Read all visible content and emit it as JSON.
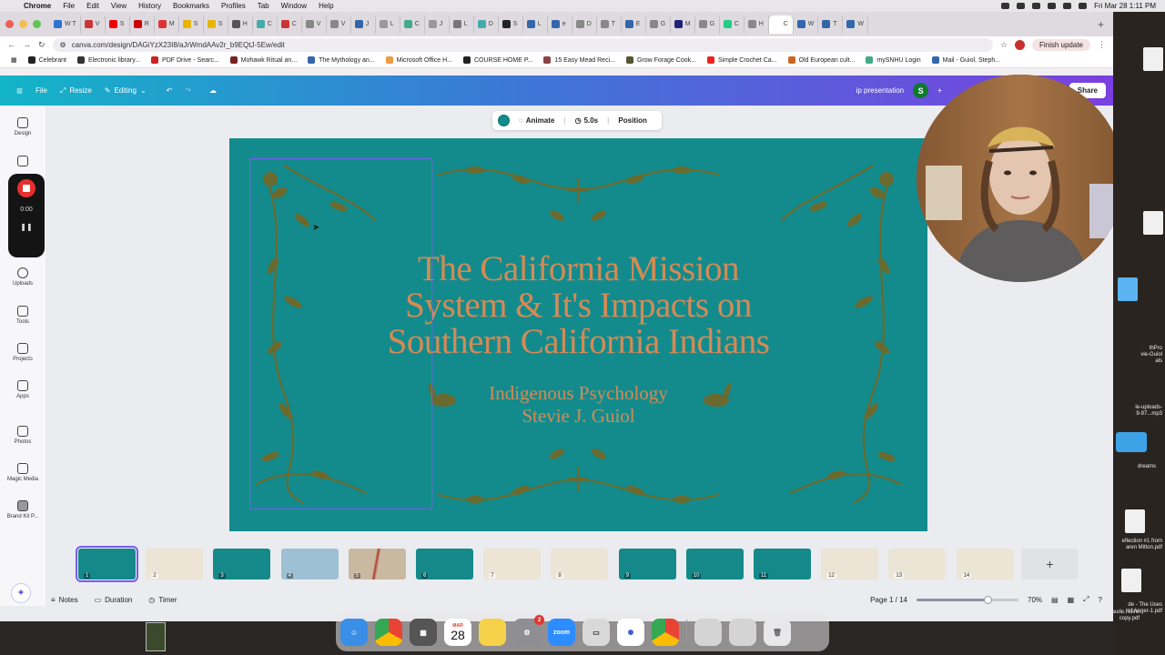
{
  "menubar": {
    "app": "Chrome",
    "items": [
      "File",
      "Edit",
      "View",
      "History",
      "Bookmarks",
      "Profiles",
      "Tab",
      "Window",
      "Help"
    ],
    "datetime": "Fri Mar 28  1:11 PM"
  },
  "browser": {
    "url": "canva.com/design/DAGiYzX23I8/aJrWmdAAv2r_b9EQtJ-5Ew/edit",
    "finish_update": "Finish update",
    "tabs": [
      "W T",
      "V",
      "S",
      "R",
      "M",
      "S",
      "S",
      "H",
      "C",
      "C",
      "V",
      "V",
      "J",
      "L",
      "C",
      "J",
      "L",
      "D",
      "S",
      "L",
      "e",
      "D",
      "T",
      "E",
      "G",
      "M",
      "G",
      "C",
      "H",
      "C",
      "W",
      "T",
      "W"
    ],
    "bookmarks": [
      "Celebrant",
      "Electronic library...",
      "PDF Drive - Searc...",
      "Mohawk Ritual an...",
      "The Mythology an...",
      "Microsoft Office H...",
      "COURSE HOME P...",
      "15 Easy Mead Reci...",
      "Grow Forage Cook...",
      "Simple Crochet Ca...",
      "Old European cult...",
      "mySNHU Login",
      "Mail - Guiol, Steph..."
    ]
  },
  "canva": {
    "header": {
      "file": "File",
      "resize": "Resize",
      "editing": "Editing",
      "design_name": "ip presentation",
      "avatar_letter": "S",
      "share": "Share"
    },
    "sidebar": [
      "Design",
      "Elements",
      "Uploads",
      "Tools",
      "Projects",
      "Apps",
      "Photos",
      "Magic Media",
      "Brand Kit P..."
    ],
    "recorder": {
      "time": "0:00"
    },
    "toolbar": {
      "animate": "Animate",
      "duration": "5.0s",
      "position": "Position"
    },
    "slide": {
      "title_lines": [
        "The California Mission",
        "System & It's Impacts on",
        "Southern California Indians"
      ],
      "subtitle_lines": [
        "Indigenous Psychology",
        "Stevie J. Guiol"
      ]
    },
    "pages": [
      "1",
      "2",
      "3",
      "4",
      "5",
      "6",
      "7",
      "8",
      "9",
      "10",
      "11",
      "12",
      "13",
      "14"
    ],
    "footer": {
      "notes": "Notes",
      "duration": "Duration",
      "timer": "Timer",
      "page_indicator": "Page 1 / 14",
      "zoom": "70%",
      "zoom_fraction": 0.7
    }
  },
  "colors": {
    "slide_bg": "#138b8c",
    "title": "#d68a55",
    "foliage": "#6b6a2e",
    "selection": "#7a5cf0"
  },
  "dock": {
    "calendar_month": "MAR",
    "calendar_day": "28",
    "settings_badge": "2",
    "zoom_label": "zoom"
  },
  "desktop_labels": [
    "thPro\nvie-Guiol\nals",
    "le-uploads-\n9-97...mp3",
    "dreams",
    "eflection #1 from\naren Mitton.pdf",
    "de - The Uses\nof Anger-1.pdf",
    "Glaude.Ruins\ncopy.pdf"
  ]
}
